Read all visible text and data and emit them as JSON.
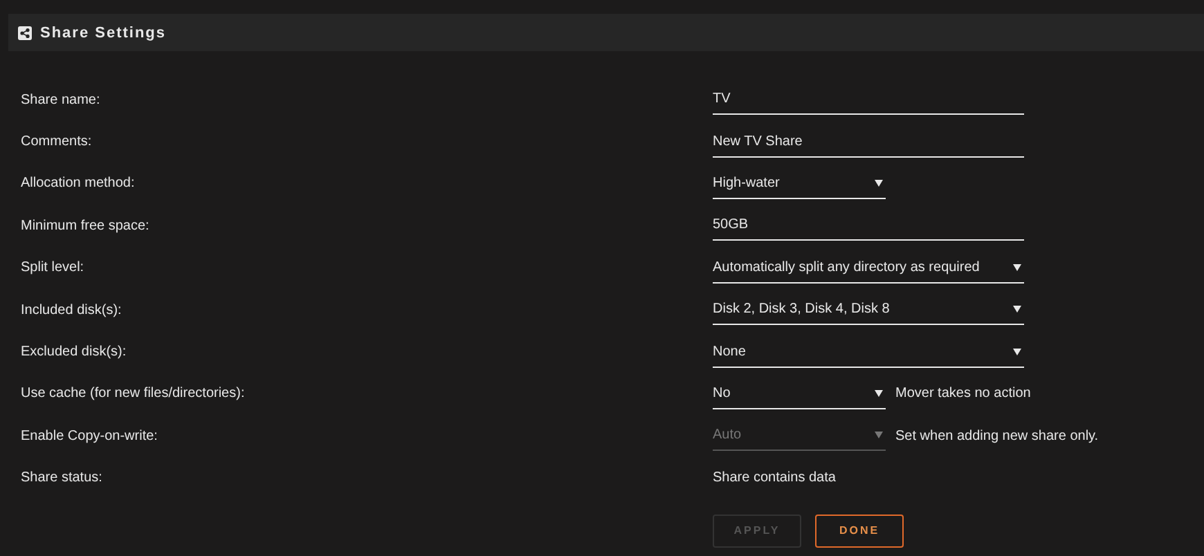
{
  "header": {
    "title": "Share Settings"
  },
  "rows": [
    {
      "label": "Share name:",
      "kind": "text",
      "value": "TV"
    },
    {
      "label": "Comments:",
      "kind": "text",
      "value": "New TV Share"
    },
    {
      "label": "Allocation method:",
      "kind": "short-select",
      "value": "High-water"
    },
    {
      "label": "Minimum free space:",
      "kind": "text",
      "value": "50GB"
    },
    {
      "label": "Split level:",
      "kind": "select",
      "value": "Automatically split any directory as required"
    },
    {
      "label": "Included disk(s):",
      "kind": "select",
      "value": "Disk 2, Disk 3, Disk 4, Disk 8"
    },
    {
      "label": "Excluded disk(s):",
      "kind": "select",
      "value": "None"
    },
    {
      "label": "Use cache (for new files/directories):",
      "kind": "short-select",
      "value": "No",
      "note": "Mover takes no action"
    },
    {
      "label": "Enable Copy-on-write:",
      "kind": "short-select",
      "value": "Auto",
      "disabled": true,
      "note": "Set when adding new share only."
    },
    {
      "label": "Share status:",
      "kind": "static",
      "value": "Share contains data"
    }
  ],
  "buttons": [
    {
      "label": "APPLY",
      "disabled": true
    },
    {
      "label": "DONE",
      "disabled": false
    }
  ]
}
